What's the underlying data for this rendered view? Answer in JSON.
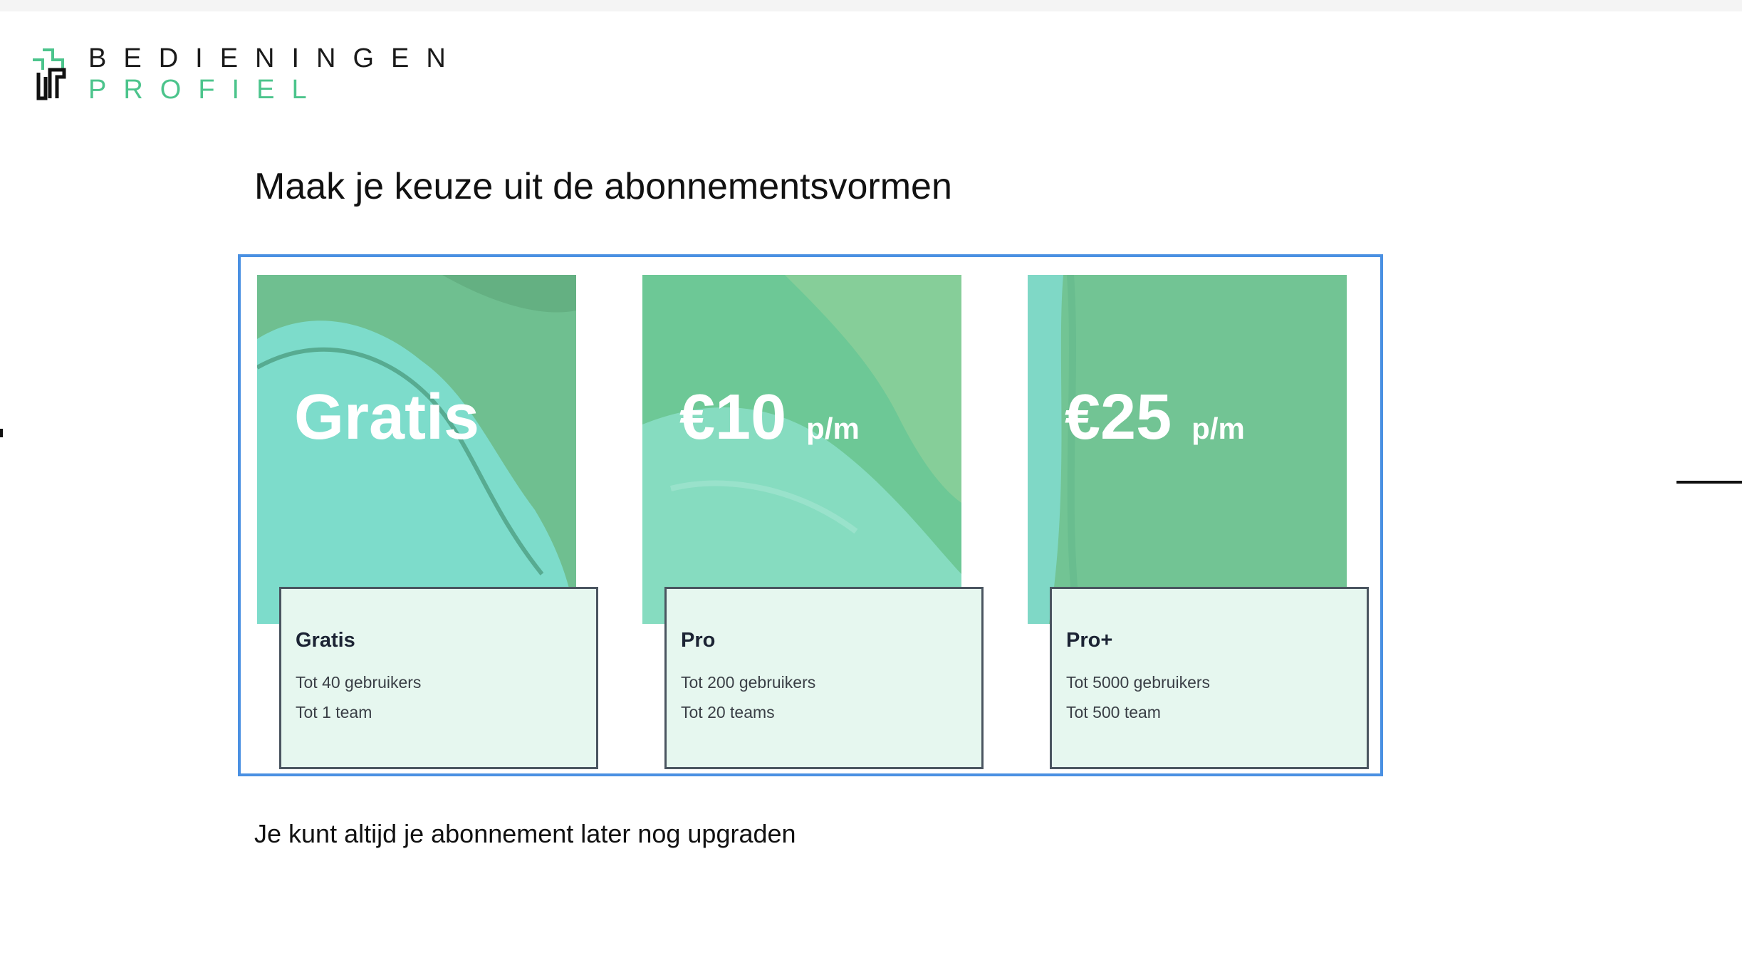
{
  "logo": {
    "line1": "BEDIENINGEN",
    "line2": "PROFIEL",
    "accent": "#4cc48c"
  },
  "heading": "Maak je keuze uit de abonnementsvormen",
  "plans": [
    {
      "price": "Gratis",
      "unit": "",
      "name": "Gratis",
      "line1": "Tot 40 gebruikers",
      "line2": "Tot 1 team"
    },
    {
      "price": "€10",
      "unit": "p/m",
      "name": "Pro",
      "line1": "Tot 200 gebruikers",
      "line2": "Tot 20 teams"
    },
    {
      "price": "€25",
      "unit": "p/m",
      "name": "Pro+",
      "line1": "Tot 5000 gebruikers",
      "line2": "Tot 500 team"
    }
  ],
  "footnote": "Je kunt altijd je abonnement later nog upgraden",
  "colors": {
    "selection_border": "#4a90e2",
    "info_bg": "#e6f7ef",
    "card_green": "#6fc89a",
    "card_teal": "#7ddccb"
  }
}
